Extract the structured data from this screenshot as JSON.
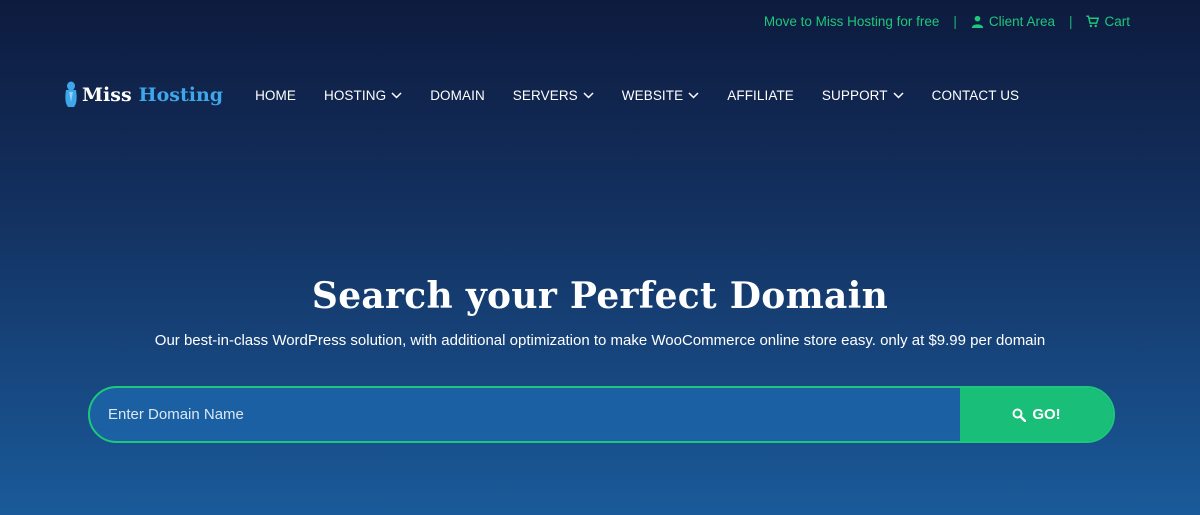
{
  "topbar": {
    "migrate_link": "Move to Miss Hosting for free",
    "separator": "|",
    "client_area": "Client Area",
    "cart": "Cart",
    "accent_color": "#1ec77a"
  },
  "logo": {
    "word1": "Miss",
    "word2": "Hosting"
  },
  "nav": {
    "home": "HOME",
    "hosting": "HOSTING",
    "domain": "DOMAIN",
    "servers": "SERVERS",
    "website": "WEBSITE",
    "affiliate": "AFFILIATE",
    "support": "SUPPORT",
    "contact": "CONTACT US"
  },
  "hero": {
    "title": "Search your Perfect Domain",
    "subtitle": "Our best-in-class WordPress solution, with additional optimization to make WooCommerce online store easy. only at $9.99 per domain"
  },
  "search": {
    "placeholder": "Enter Domain Name",
    "value": "",
    "button_label": "GO!"
  }
}
